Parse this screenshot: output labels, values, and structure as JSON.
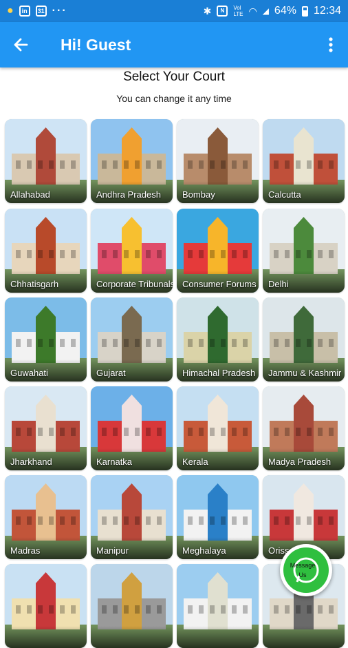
{
  "status_bar": {
    "battery": "64%",
    "time": "12:34",
    "left_icons": [
      "bulb-icon",
      "inbox-icon",
      "calendar-icon",
      "more-dots-icon"
    ],
    "right_icons": [
      "bluetooth-icon",
      "nfc-icon",
      "volte-icon",
      "wifi-icon",
      "signal-icon",
      "battery-icon"
    ]
  },
  "app_bar": {
    "title": "Hi! Guest",
    "back_icon": "arrow-left-icon",
    "menu_icon": "more-vert-icon",
    "color": "#2196f3"
  },
  "header": {
    "title": "Select Your Court",
    "subtitle": "You can change it any time"
  },
  "courts": [
    {
      "label": "Allahabad",
      "sky": "#cfe4f5",
      "building": "#d9c9b2",
      "accent": "#b04a3a"
    },
    {
      "label": "Andhra Pradesh",
      "sky": "#8fc3ef",
      "building": "#c9b89a",
      "accent": "#f0a030"
    },
    {
      "label": "Bombay",
      "sky": "#e9eef3",
      "building": "#b88c6b",
      "accent": "#8a5a3a"
    },
    {
      "label": "Calcutta",
      "sky": "#bfdaf0",
      "building": "#c0503a",
      "accent": "#e9e4d0"
    },
    {
      "label": "Chhatisgarh",
      "sky": "#c9e1f5",
      "building": "#e7d6bc",
      "accent": "#b84a2a"
    },
    {
      "label": "Corporate Tribunals",
      "sky": "#cfe6f7",
      "building": "#e04c6a",
      "accent": "#f7c030"
    },
    {
      "label": "Consumer Forums",
      "sky": "#3aa7e0",
      "building": "#e53a3a",
      "accent": "#f7b52a"
    },
    {
      "label": "Delhi",
      "sky": "#e8eef2",
      "building": "#d8d2c5",
      "accent": "#4c8a3c"
    },
    {
      "label": "Guwahati",
      "sky": "#7cbce8",
      "building": "#f2f2f2",
      "accent": "#3d7a2a"
    },
    {
      "label": "Gujarat",
      "sky": "#9ccdf0",
      "building": "#d8d3c8",
      "accent": "#7a6a50"
    },
    {
      "label": "Himachal Pradesh",
      "sky": "#cfe2e8",
      "building": "#dad3a8",
      "accent": "#2f6a2f"
    },
    {
      "label": "Jammu & Kashmir",
      "sky": "#dde6ea",
      "building": "#c8bfa8",
      "accent": "#3f6a3a"
    },
    {
      "label": "Jharkhand",
      "sky": "#d9e8f3",
      "building": "#b8483a",
      "accent": "#e9e0d0"
    },
    {
      "label": "Karnatka",
      "sky": "#6cb0e8",
      "building": "#d8383a",
      "accent": "#f0e0e0"
    },
    {
      "label": "Kerala",
      "sky": "#c5dff2",
      "building": "#c85a3a",
      "accent": "#f0e6d8"
    },
    {
      "label": "Madya Pradesh",
      "sky": "#e6ecf0",
      "building": "#c07a5a",
      "accent": "#a84a3a"
    },
    {
      "label": "Madras",
      "sky": "#bcdaf3",
      "building": "#c2553a",
      "accent": "#e8c090"
    },
    {
      "label": "Manipur",
      "sky": "#a9d2f3",
      "building": "#e8e0d0",
      "accent": "#b8483a"
    },
    {
      "label": "Meghalaya",
      "sky": "#8fc8ef",
      "building": "#f2f2f2",
      "accent": "#2a80c8"
    },
    {
      "label": "Orissa",
      "sky": "#d9e6ef",
      "building": "#c8383a",
      "accent": "#f0e8e0"
    },
    {
      "label": "",
      "sky": "#c9e1f3",
      "building": "#f0e0b0",
      "accent": "#c8383a"
    },
    {
      "label": "",
      "sky": "#bcd6ea",
      "building": "#9a9a9a",
      "accent": "#d0a040"
    },
    {
      "label": "",
      "sky": "#9ccdf0",
      "building": "#f2f2f2",
      "accent": "#e0e0d0"
    },
    {
      "label": "",
      "sky": "#dde8ef",
      "building": "#e0d8c8",
      "accent": "#6a6a6a"
    }
  ],
  "whatsapp_button": {
    "text_line1": "Message",
    "text_line2": "Us",
    "icon": "whatsapp-icon",
    "color": "#2fbf3f"
  }
}
